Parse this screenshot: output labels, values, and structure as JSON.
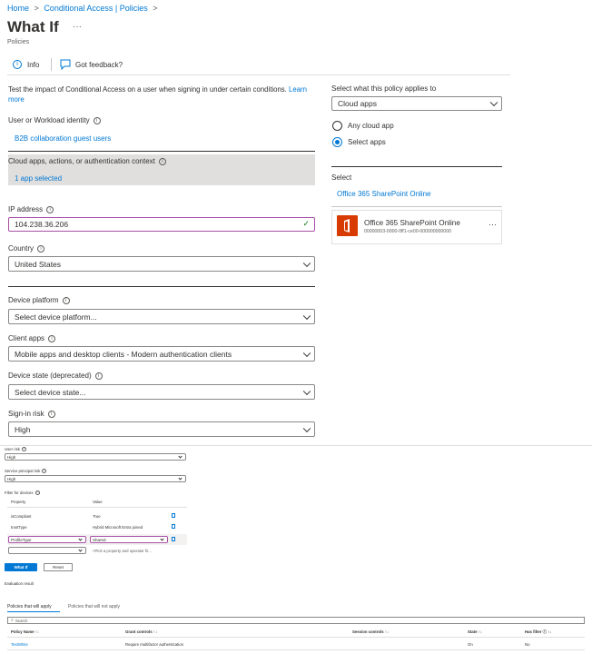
{
  "breadcrumb": {
    "home": "Home",
    "sep1": ">",
    "ca": "Conditional Access | Policies",
    "sep2": ">"
  },
  "header": {
    "title": "What If",
    "more": "···",
    "subtitle": "Policies"
  },
  "toolbar": {
    "info": "Info",
    "feedback": "Got feedback?"
  },
  "intro": {
    "text": "Test the impact of Conditional Access on a user when signing in under certain conditions.",
    "learn_more": "Learn more"
  },
  "left": {
    "identity_label": "User or Workload identity",
    "identity_value": "B2B collaboration guest users",
    "cloud_label": "Cloud apps, actions, or authentication context",
    "cloud_value": "1 app selected",
    "ip_label": "IP address",
    "ip_value": "104.238.36.206",
    "country_label": "Country",
    "country_value": "United States",
    "device_platform_label": "Device platform",
    "device_platform_value": "Select device platform...",
    "client_apps_label": "Client apps",
    "client_apps_value": "Mobile apps and desktop clients - Modern authentication clients",
    "device_state_label": "Device state (deprecated)",
    "device_state_value": "Select device state...",
    "signin_risk_label": "Sign-in risk",
    "signin_risk_value": "High"
  },
  "right": {
    "applies_label": "Select what this policy applies to",
    "applies_value": "Cloud apps",
    "radio_any": "Any cloud app",
    "radio_select": "Select apps",
    "select_label": "Select",
    "select_link": "Office 365 SharePoint Online",
    "app_name": "Office 365 SharePoint Online",
    "app_id": "00000003-0000-0ff1-ce00-000000000000",
    "app_more": "···"
  },
  "lower": {
    "user_risk_label": "User risk",
    "user_risk_value": "High",
    "sp_risk_label": "Service principal risk",
    "sp_risk_value": "High",
    "filter_label": "Filter for devices",
    "col_property": "Property",
    "col_value": "Value",
    "rows": [
      {
        "property": "isCompliant",
        "value": "True"
      },
      {
        "property": "trustType",
        "value": "Hybrid Microsoft Entra joined"
      }
    ],
    "edit_property": "ProfileType",
    "edit_value": "Shared",
    "new_placeholder": "<Pick a property and operator fir...",
    "whatif_btn": "What If",
    "reset_btn": "Reset",
    "eval_label": "Evaluation result",
    "tab_apply": "Policies that will apply",
    "tab_not_apply": "Policies that will not apply",
    "search_placeholder": "Search",
    "cols": [
      "Policy Name ↑↓",
      "Grant controls ↑↓",
      "Session controls ↑↓",
      "State ↑↓",
      "Has filter ⓘ ↑↓"
    ],
    "result_row": {
      "name": "TestWhite",
      "grant": "Require multifactor authentication",
      "session": "",
      "state": "On",
      "filter": "No"
    }
  }
}
